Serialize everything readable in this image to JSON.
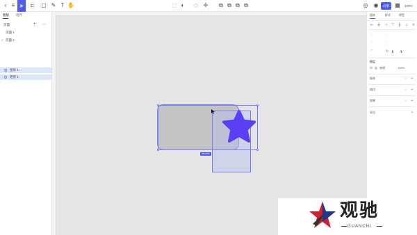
{
  "toolbar": {
    "share_label": "分享",
    "zoom_label": "100%",
    "accent": "#4f5cf0"
  },
  "left_panel": {
    "tabs": [
      "图层",
      "组件"
    ],
    "pages_heading": "页面",
    "pages": [
      "页面 1",
      "页面 2"
    ],
    "layers": [
      "星形 1",
      "矩形 1"
    ]
  },
  "canvas": {
    "size_label": "456x256",
    "rect_fill": "#c4c4c4",
    "star_fill": "#5b3ff5",
    "selection_color": "#6f7df0"
  },
  "right_panel": {
    "tabs": [
      "设计",
      "样式",
      "原型"
    ],
    "section_title": "图层",
    "opacity_label": "穿透",
    "opacity_value": "100%",
    "sections": [
      "填充",
      "描边",
      "效果",
      "导出"
    ]
  },
  "watermark": {
    "title": "观驰",
    "subtitle": "GUANCHI"
  }
}
